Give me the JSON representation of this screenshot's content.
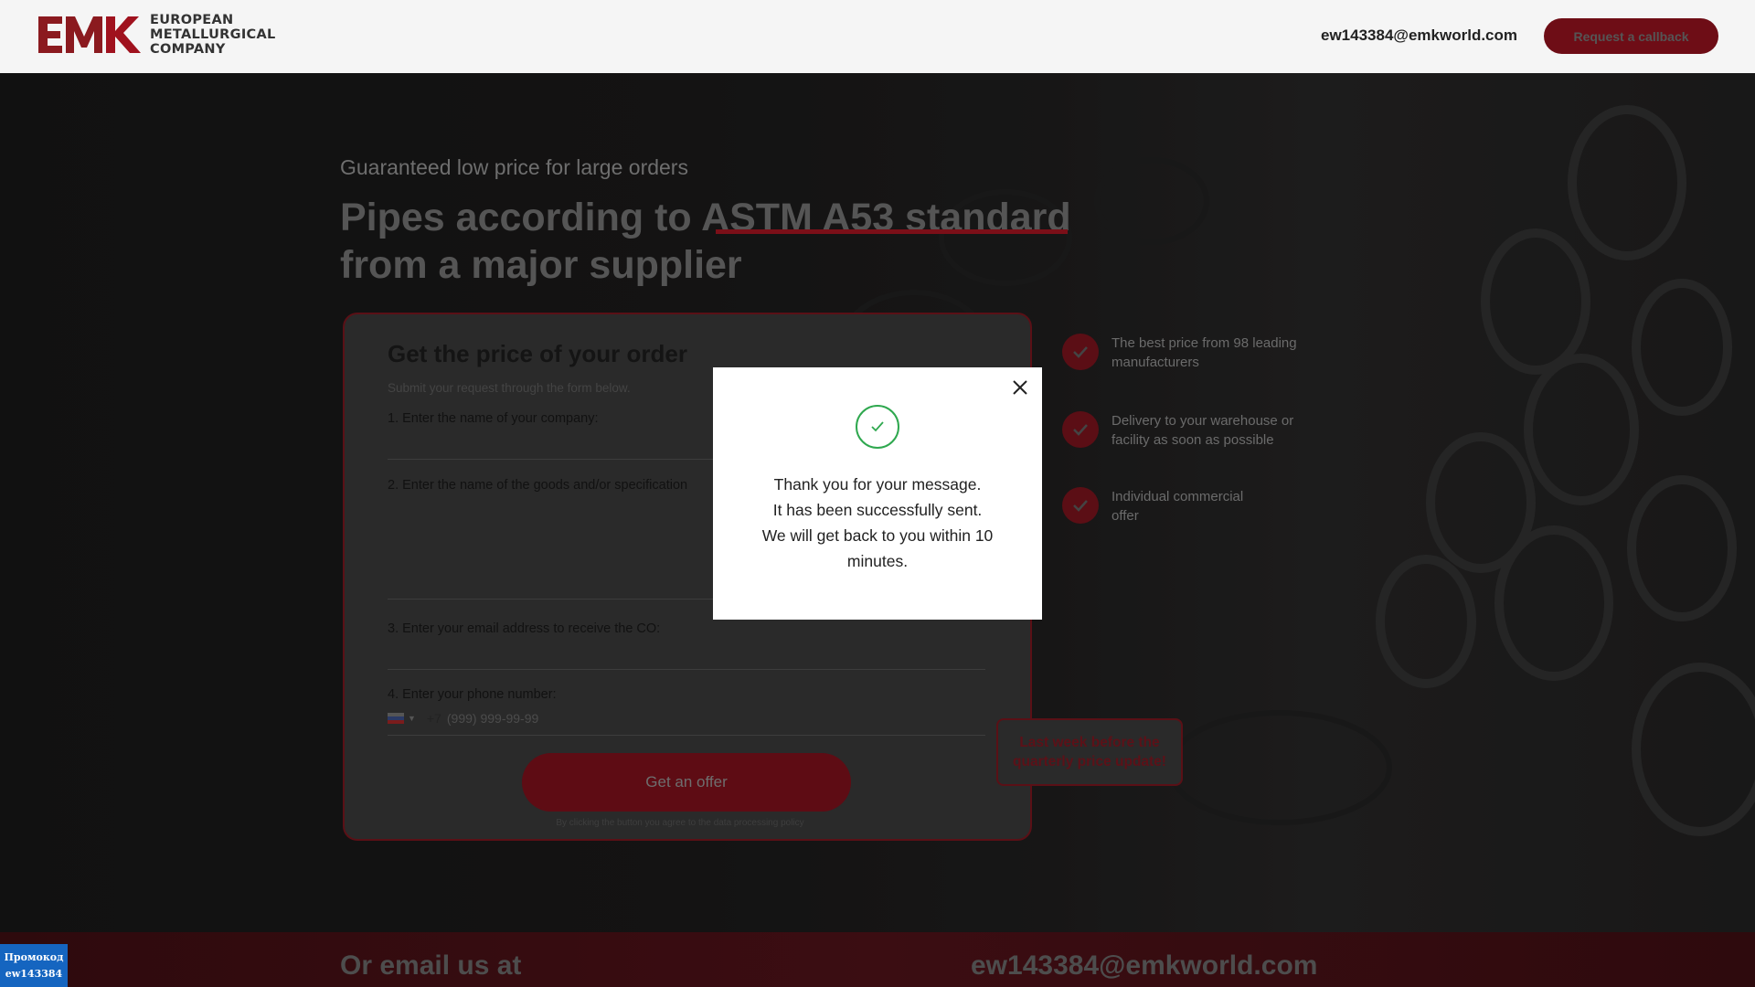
{
  "header": {
    "logo_letters": "EMK",
    "logo_line1": "EUROPEAN",
    "logo_line2": "METALLURGICAL",
    "logo_line3": "COMPANY",
    "email": "ew143384@emkworld.com",
    "callback_label": "Request a callback"
  },
  "hero": {
    "subtitle": "Guaranteed low price for large orders",
    "title_part1": "Pipes according to",
    "title_highlight": "ASTM A53 standard",
    "title_part2": "from a major supplier"
  },
  "form": {
    "title": "Get the price of your order",
    "subtitle": "Submit your request through the form below.",
    "label_company": "1. Enter the name of your company:",
    "label_goods": "2. Enter the name of the goods and/or specification",
    "label_email": "3. Enter your email address to receive the CO:",
    "label_phone": "4. Enter your phone number:",
    "phone_code": "+7",
    "phone_placeholder": "(999) 999-99-99",
    "submit_label": "Get an offer",
    "policy": "By clicking the button you agree to the data processing policy"
  },
  "benefits": [
    {
      "text": "The best price from 98 leading manufacturers"
    },
    {
      "text": "Delivery to your warehouse or facility as soon as possible"
    },
    {
      "text": "Individual commercial offer"
    }
  ],
  "promo_notice": "Last week before the quarterly price update!",
  "footer": {
    "left": "Or email us at",
    "right": "ew143384@emkworld.com"
  },
  "promo_badge": {
    "line1": "Промокод",
    "line2": "ew143384"
  },
  "modal": {
    "line1": "Thank you for your message.",
    "line2": "It has been successfully sent.",
    "line3": "We will get back to you within 10 minutes."
  },
  "colors": {
    "brand_red": "#a0121e",
    "success_green": "#2fa84f",
    "badge_blue": "#1565c0"
  }
}
